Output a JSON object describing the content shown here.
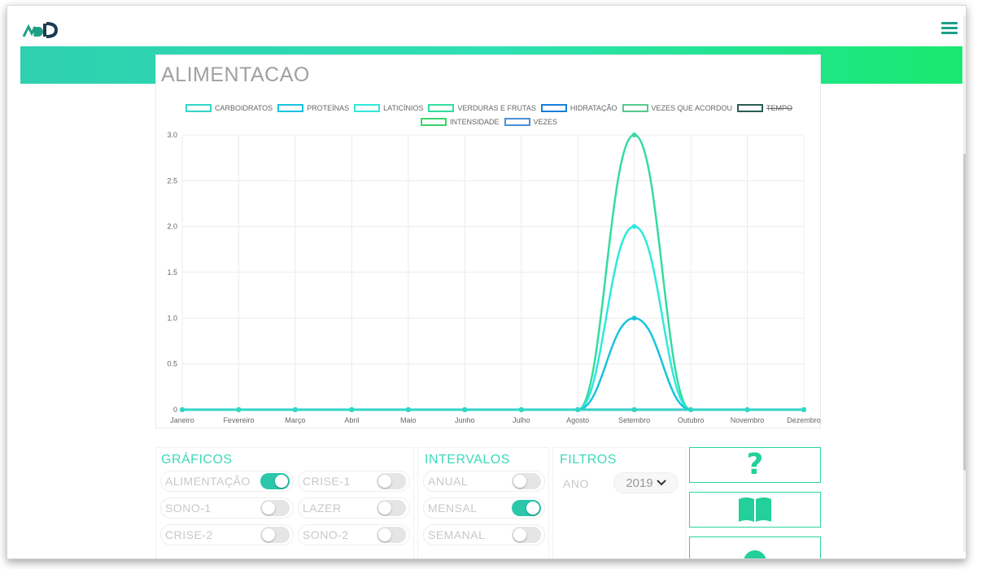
{
  "header": {
    "logo_icon": "mud-logo-icon",
    "menu_icon": "hamburger-menu-icon",
    "accent": "#2fd0b0"
  },
  "card": {
    "title": "ALIMENTACAO"
  },
  "chart_data": {
    "type": "line",
    "categories": [
      "Janeiro",
      "Fevereiro",
      "Março",
      "Abril",
      "Maio",
      "Junho",
      "Julho",
      "Agosto",
      "Setembro",
      "Outubro",
      "Novembro",
      "Dezembro"
    ],
    "ylim": [
      0,
      3
    ],
    "yticks": [
      "0",
      "0.5",
      "1.0",
      "1.5",
      "2.0",
      "2.5",
      "3.0"
    ],
    "grid": true,
    "legend_placement": "top",
    "series": [
      {
        "name": "CARBOIDRATOS",
        "color": "#32d6c6",
        "hidden": false,
        "values": [
          0,
          0,
          0,
          0,
          0,
          0,
          0,
          0,
          0,
          0,
          0,
          0
        ]
      },
      {
        "name": "PROTEÍNAS",
        "color": "#18c3dd",
        "hidden": false,
        "values": [
          0,
          0,
          0,
          0,
          0,
          0,
          0,
          0,
          1,
          0,
          0,
          0
        ]
      },
      {
        "name": "LATICÍNIOS",
        "color": "#2fe9dc",
        "hidden": false,
        "values": [
          0,
          0,
          0,
          0,
          0,
          0,
          0,
          0,
          2,
          0,
          0,
          0
        ]
      },
      {
        "name": "VERDURAS E FRUTAS",
        "color": "#33dc9f",
        "hidden": false,
        "values": [
          0,
          0,
          0,
          0,
          0,
          0,
          0,
          0,
          3,
          0,
          0,
          0
        ]
      },
      {
        "name": "HIDRATAÇÃO",
        "color": "#1a7fdc",
        "hidden": false,
        "values": [
          0,
          0,
          0,
          0,
          0,
          0,
          0,
          0,
          0,
          0,
          0,
          0
        ]
      },
      {
        "name": "VEZES QUE ACORDOU",
        "color": "#55c98f",
        "hidden": false,
        "values": [
          0,
          0,
          0,
          0,
          0,
          0,
          0,
          0,
          0,
          0,
          0,
          0
        ]
      },
      {
        "name": "TEMPO",
        "color": "#2a5e52",
        "hidden": true,
        "values": [
          0,
          0,
          0,
          0,
          0,
          0,
          0,
          0,
          0,
          0,
          0,
          0
        ]
      },
      {
        "name": "INTENSIDADE",
        "color": "#3bd36a",
        "hidden": false,
        "values": [
          0,
          0,
          0,
          0,
          0,
          0,
          0,
          0,
          0,
          0,
          0,
          0
        ]
      },
      {
        "name": "VEZES",
        "color": "#4a90d9",
        "hidden": false,
        "values": [
          0,
          0,
          0,
          0,
          0,
          0,
          0,
          0,
          0,
          0,
          0,
          0
        ]
      }
    ]
  },
  "graficos": {
    "title": "GRÁFICOS",
    "toggles": [
      {
        "label": "ALIMENTAÇÃO",
        "on": true
      },
      {
        "label": "CRISE-1",
        "on": false
      },
      {
        "label": "SONO-1",
        "on": false
      },
      {
        "label": "LAZER",
        "on": false
      },
      {
        "label": "CRISE-2",
        "on": false
      },
      {
        "label": "SONO-2",
        "on": false
      }
    ]
  },
  "intervalos": {
    "title": "INTERVALOS",
    "toggles": [
      {
        "label": "ANUAL",
        "on": false
      },
      {
        "label": "MENSAL",
        "on": true
      },
      {
        "label": "SEMANAL",
        "on": false
      }
    ]
  },
  "filtros": {
    "title": "FILTROS",
    "ano_label": "ANO",
    "ano_value": "2019"
  },
  "actions": {
    "help_icon": "question-mark-icon",
    "book_icon": "open-book-icon",
    "third_icon": "circle-icon"
  }
}
